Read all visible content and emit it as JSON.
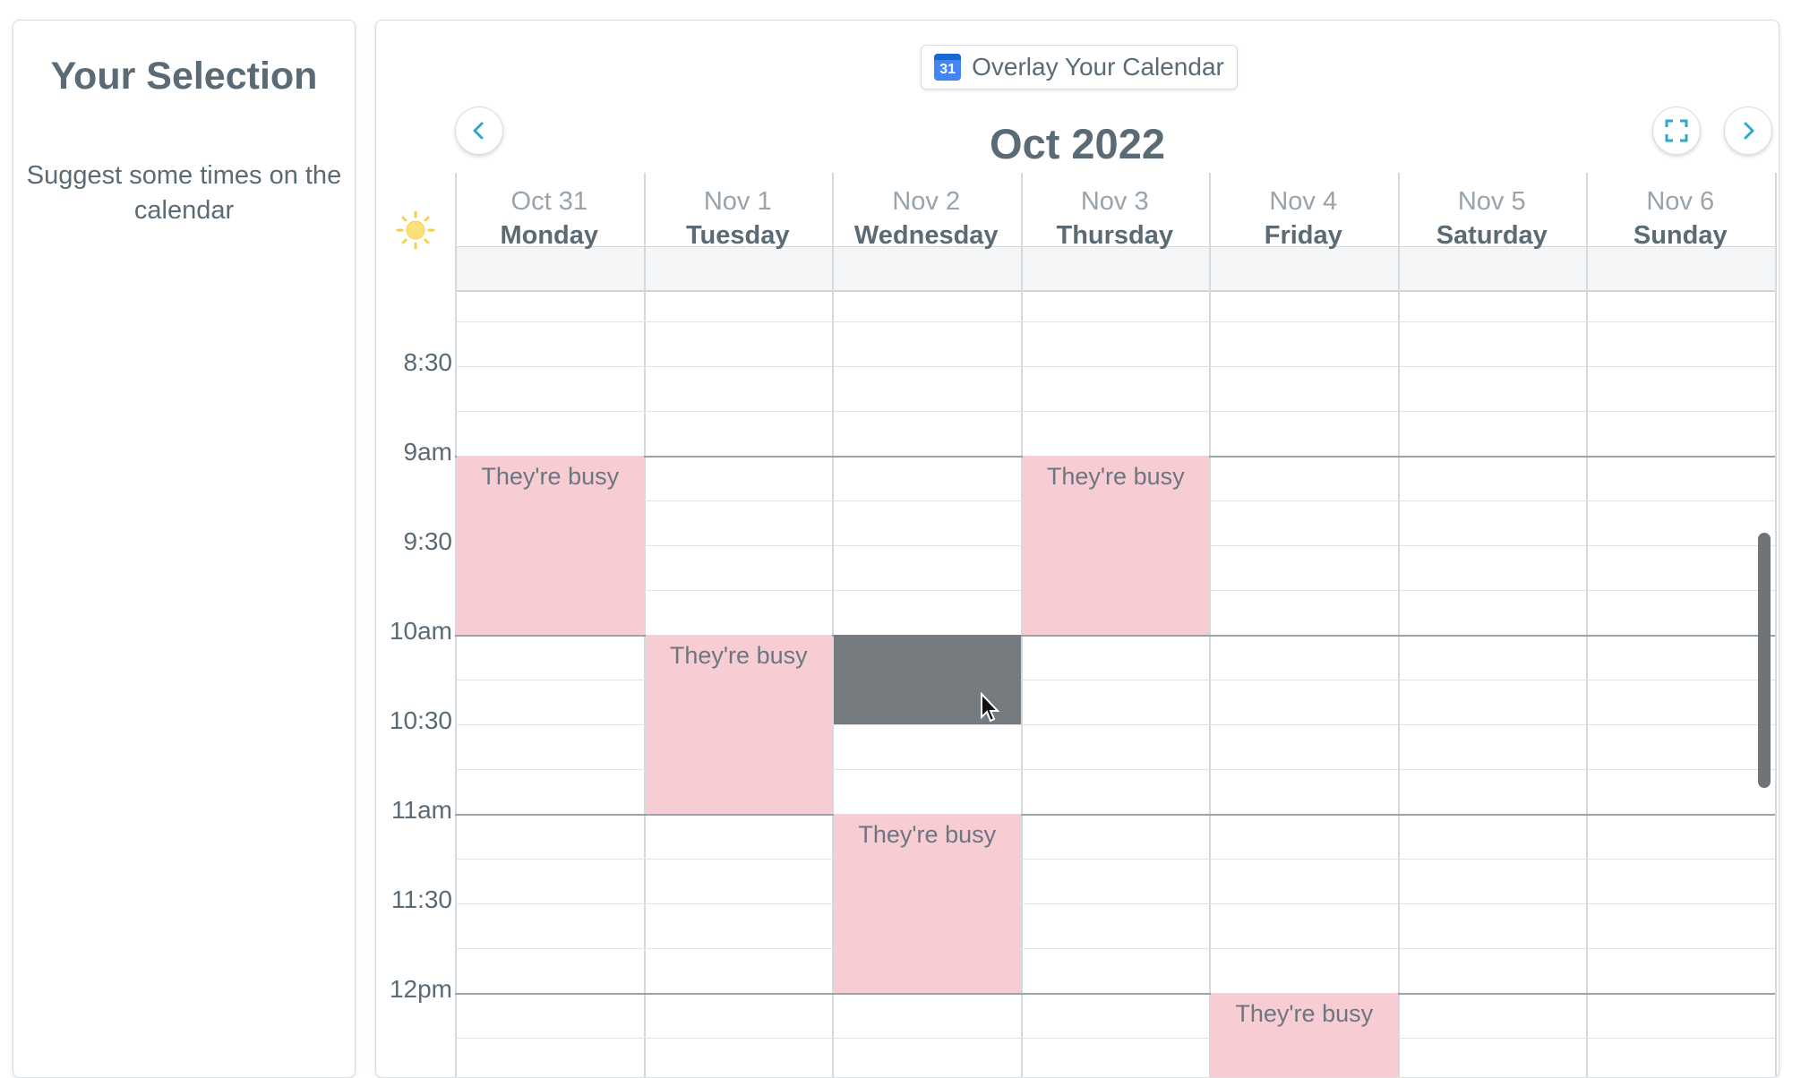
{
  "left_panel": {
    "title": "Your Selection",
    "hint": "Suggest some times on the calendar"
  },
  "toolbar": {
    "overlay_label": "Overlay Your Calendar",
    "calendar_icon_text": "31",
    "month_title": "Oct 2022"
  },
  "days": [
    {
      "date": "Oct 31",
      "name": "Monday"
    },
    {
      "date": "Nov 1",
      "name": "Tuesday"
    },
    {
      "date": "Nov 2",
      "name": "Wednesday"
    },
    {
      "date": "Nov 3",
      "name": "Thursday"
    },
    {
      "date": "Nov 4",
      "name": "Friday"
    },
    {
      "date": "Nov 5",
      "name": "Saturday"
    },
    {
      "date": "Nov 6",
      "name": "Sunday"
    }
  ],
  "time_labels": [
    "8:30",
    "9am",
    "9:30",
    "10am",
    "10:30",
    "11am",
    "11:30",
    "12pm"
  ],
  "busy_label": "They're busy",
  "busy_blocks": [
    {
      "day": 0,
      "start": "9am",
      "end": "10am"
    },
    {
      "day": 1,
      "start": "10am",
      "end": "11am"
    },
    {
      "day": 3,
      "start": "9am",
      "end": "10am"
    },
    {
      "day": 2,
      "start": "11am",
      "end": "12pm"
    },
    {
      "day": 4,
      "start": "12pm",
      "end": "12:30"
    }
  ],
  "selection": {
    "day": 2,
    "start": "10am",
    "end": "10:30"
  },
  "colors": {
    "busy": "#f7ccd3",
    "selection": "#757b7f",
    "accent": "#2fa9c8",
    "text": "#5a6b75"
  },
  "icons": {
    "prev": "chevron-left-icon",
    "next": "chevron-right-icon",
    "fullscreen": "fullscreen-icon",
    "sun": "sun-icon",
    "calendar": "google-calendar-icon"
  }
}
